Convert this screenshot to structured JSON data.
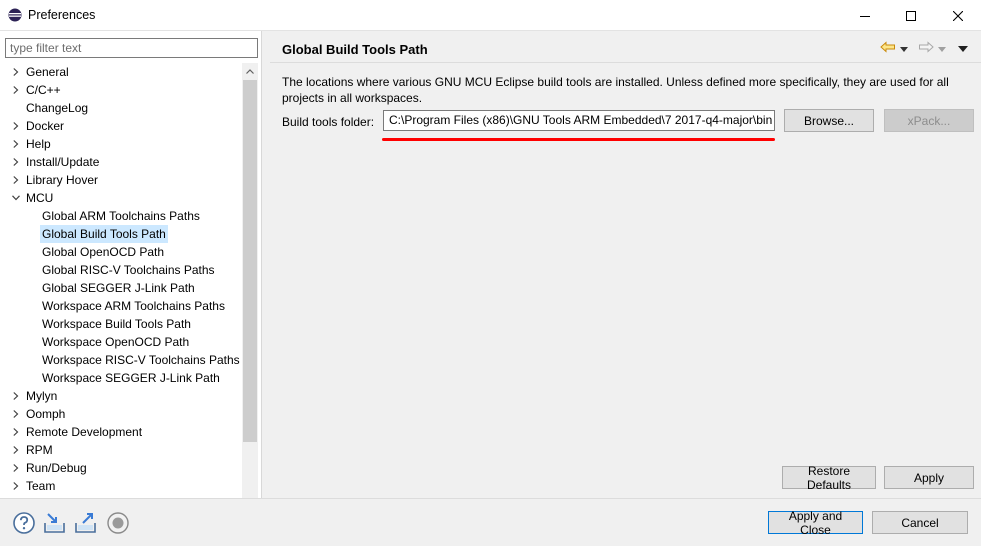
{
  "window": {
    "title": "Preferences",
    "controls": [
      "minimize",
      "maximize",
      "close"
    ]
  },
  "sidebar": {
    "filter_placeholder": "type filter text",
    "items": [
      {
        "label": "General",
        "expandable": true,
        "expanded": false,
        "level": 0
      },
      {
        "label": "C/C++",
        "expandable": true,
        "expanded": false,
        "level": 0
      },
      {
        "label": "ChangeLog",
        "expandable": false,
        "level": 0
      },
      {
        "label": "Docker",
        "expandable": true,
        "expanded": false,
        "level": 0
      },
      {
        "label": "Help",
        "expandable": true,
        "expanded": false,
        "level": 0
      },
      {
        "label": "Install/Update",
        "expandable": true,
        "expanded": false,
        "level": 0
      },
      {
        "label": "Library Hover",
        "expandable": true,
        "expanded": false,
        "level": 0
      },
      {
        "label": "MCU",
        "expandable": true,
        "expanded": true,
        "level": 0
      },
      {
        "label": "Global ARM Toolchains Paths",
        "expandable": false,
        "level": 1
      },
      {
        "label": "Global Build Tools Path",
        "expandable": false,
        "level": 1,
        "selected": true
      },
      {
        "label": "Global OpenOCD Path",
        "expandable": false,
        "level": 1
      },
      {
        "label": "Global RISC-V Toolchains Paths",
        "expandable": false,
        "level": 1
      },
      {
        "label": "Global SEGGER J-Link Path",
        "expandable": false,
        "level": 1
      },
      {
        "label": "Workspace ARM Toolchains Paths",
        "expandable": false,
        "level": 1
      },
      {
        "label": "Workspace Build Tools Path",
        "expandable": false,
        "level": 1
      },
      {
        "label": "Workspace OpenOCD Path",
        "expandable": false,
        "level": 1
      },
      {
        "label": "Workspace RISC-V Toolchains Paths",
        "expandable": false,
        "level": 1
      },
      {
        "label": "Workspace SEGGER J-Link Path",
        "expandable": false,
        "level": 1
      },
      {
        "label": "Mylyn",
        "expandable": true,
        "expanded": false,
        "level": 0
      },
      {
        "label": "Oomph",
        "expandable": true,
        "expanded": false,
        "level": 0
      },
      {
        "label": "Remote Development",
        "expandable": true,
        "expanded": false,
        "level": 0
      },
      {
        "label": "RPM",
        "expandable": true,
        "expanded": false,
        "level": 0
      },
      {
        "label": "Run/Debug",
        "expandable": true,
        "expanded": false,
        "level": 0
      },
      {
        "label": "Team",
        "expandable": true,
        "expanded": false,
        "level": 0
      }
    ]
  },
  "page": {
    "title": "Global Build Tools Path",
    "description": "The locations where various GNU MCU Eclipse build tools are installed. Unless defined more specifically, they are used for all projects in all workspaces.",
    "field_label": "Build tools folder:",
    "field_value": "C:\\Program Files (x86)\\GNU Tools ARM Embedded\\7 2017-q4-major\\bin",
    "browse_label": "Browse...",
    "xpack_label": "xPack...",
    "restore_defaults_label": "Restore Defaults",
    "apply_label": "Apply"
  },
  "footer": {
    "icons": [
      "help-icon",
      "import-icon",
      "export-icon",
      "record-icon"
    ],
    "apply_close_label": "Apply and Close",
    "cancel_label": "Cancel"
  },
  "colors": {
    "selection": "#cce8ff",
    "highlight_underline": "#ff0000",
    "default_button_border": "#0078d7",
    "back_arrow": "#e8a317"
  }
}
